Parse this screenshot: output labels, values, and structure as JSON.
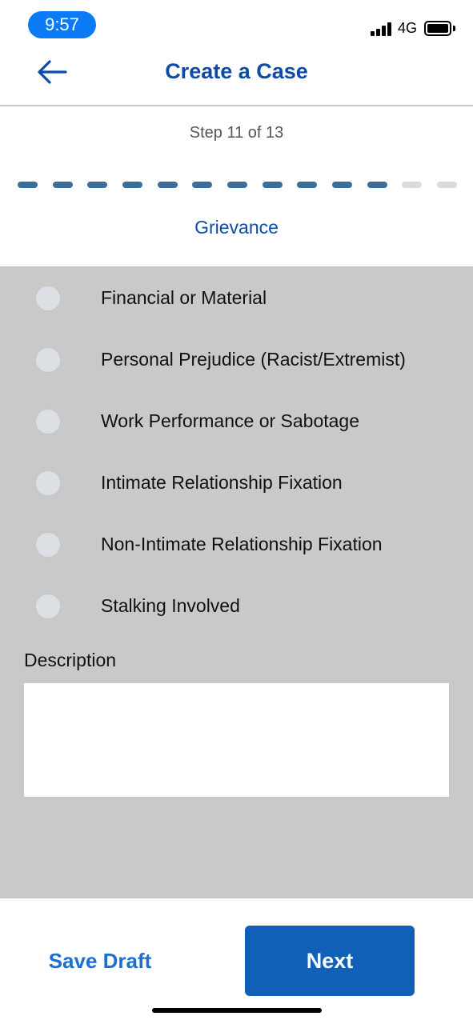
{
  "status_bar": {
    "time": "9:57",
    "network": "4G"
  },
  "header": {
    "title": "Create a Case",
    "back_icon": "arrow-left-icon"
  },
  "step": {
    "label": "Step 11 of 13",
    "current": 11,
    "total": 13,
    "active_color": "#3a6e9b",
    "inactive_color": "#d9dbdc"
  },
  "section": {
    "title": "Grievance"
  },
  "options": [
    {
      "label": "Financial or Material",
      "selected": false
    },
    {
      "label": "Personal Prejudice (Racist/Extremist)",
      "selected": false
    },
    {
      "label": "Work Performance or Sabotage",
      "selected": false
    },
    {
      "label": "Intimate Relationship Fixation",
      "selected": false
    },
    {
      "label": "Non-Intimate Relationship Fixation",
      "selected": false
    },
    {
      "label": "Stalking Involved",
      "selected": false
    }
  ],
  "description": {
    "label": "Description",
    "value": ""
  },
  "footer": {
    "save_draft_label": "Save Draft",
    "next_label": "Next"
  },
  "colors": {
    "brand": "#0d4ba8",
    "primary_button": "#1160b8",
    "form_background": "#c8c9c8",
    "time_pill": "#0a7bf5"
  }
}
